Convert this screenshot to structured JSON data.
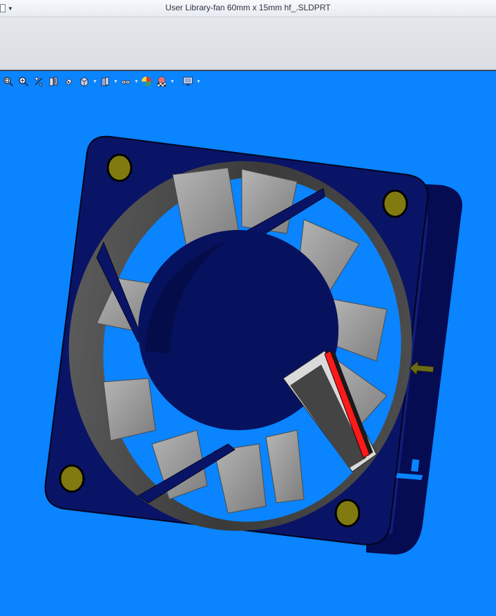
{
  "window": {
    "title": "User Library-fan 60mm x 15mm hf_.SLDPRT",
    "doc_menu_icon": "document-menu-icon"
  },
  "view_toolbar": {
    "items": [
      {
        "name": "zoom-to-fit-icon",
        "label": "Zoom to Fit"
      },
      {
        "name": "zoom-to-area-icon",
        "label": "Zoom to Area"
      },
      {
        "name": "previous-view-icon",
        "label": "Previous View"
      },
      {
        "name": "section-view-icon",
        "label": "Section View"
      },
      {
        "name": "dynamic-annotation-icon",
        "label": "Dynamic Annotation Views"
      },
      {
        "name": "view-orientation-icon",
        "label": "View Orientation"
      },
      {
        "name": "display-style-icon",
        "label": "Display Style"
      },
      {
        "name": "hide-show-items-icon",
        "label": "Hide/Show Items"
      },
      {
        "name": "edit-appearance-icon",
        "label": "Edit Appearance"
      },
      {
        "name": "apply-scene-icon",
        "label": "Apply Scene"
      },
      {
        "name": "view-settings-icon",
        "label": "View Settings"
      }
    ]
  },
  "colors": {
    "viewport_bg": "#0a84ff",
    "fan_frame": "#0a1466",
    "blade": "#9a9a9a",
    "wire_red": "#ff1a1a",
    "mount_hole": "#807a10"
  }
}
